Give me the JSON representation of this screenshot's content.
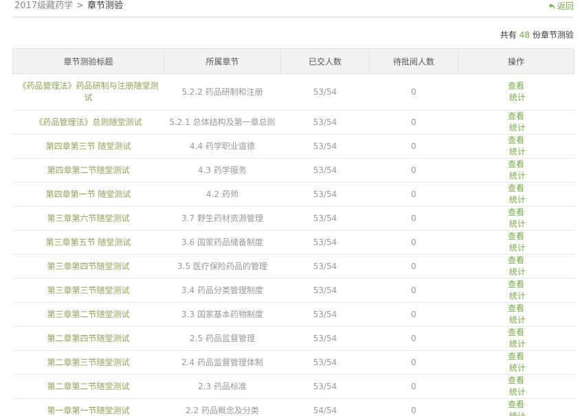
{
  "breadcrumb": {
    "course": "2017级藏药学",
    "separator": ">",
    "current": "章节测验"
  },
  "back": {
    "label": "返回",
    "icon": "return-arrow-icon"
  },
  "summary": {
    "prefix": "共有",
    "count": "48",
    "suffix": "份章节测验"
  },
  "colors": {
    "accent": "#78a949",
    "title_link": "#8ea45b",
    "header_bg": "#f2f2f2"
  },
  "table": {
    "headers": [
      "章节测验标题",
      "所属章节",
      "已交人数",
      "待批阅人数",
      "操作"
    ],
    "rows": [
      {
        "title": "《药品管理法》药品研制与注册随堂测试",
        "chapter": "5.2.2 药品研制和注册",
        "submitted": "53/54",
        "pending": "0",
        "view": "查看",
        "stats": "统计"
      },
      {
        "title": "《药品管理法》总则随堂测试",
        "chapter": "5.2.1 总体结构及第一章总则",
        "submitted": "53/54",
        "pending": "0",
        "view": "查看",
        "stats": "统计"
      },
      {
        "title": "第四章第三节 随堂测试",
        "chapter": "4.4 药学职业道德",
        "submitted": "53/54",
        "pending": "0",
        "view": "查看",
        "stats": "统计"
      },
      {
        "title": "第四章第二节随堂测试",
        "chapter": "4.3 药学服务",
        "submitted": "53/54",
        "pending": "0",
        "view": "查看",
        "stats": "统计"
      },
      {
        "title": "第四章第一节 随堂测试",
        "chapter": "4.2 药师",
        "submitted": "53/54",
        "pending": "0",
        "view": "查看",
        "stats": "统计"
      },
      {
        "title": "第三章第六节随堂测试",
        "chapter": "3.7 野生药材资源管理",
        "submitted": "53/54",
        "pending": "0",
        "view": "查看",
        "stats": "统计"
      },
      {
        "title": "第三章第五节 随堂测试",
        "chapter": "3.6 国家药品储备制度",
        "submitted": "53/54",
        "pending": "0",
        "view": "查看",
        "stats": "统计"
      },
      {
        "title": "第三章第四节随堂测试",
        "chapter": "3.5 医疗保险药品的管理",
        "submitted": "53/54",
        "pending": "0",
        "view": "查看",
        "stats": "统计"
      },
      {
        "title": "第三章第三节随堂测试",
        "chapter": "3.4 药品分类管理制度",
        "submitted": "53/54",
        "pending": "0",
        "view": "查看",
        "stats": "统计"
      },
      {
        "title": "第三章第二节随堂测试",
        "chapter": "3.3 国家基本药物制度",
        "submitted": "53/54",
        "pending": "0",
        "view": "查看",
        "stats": "统计"
      },
      {
        "title": "第二章第四节随堂测试",
        "chapter": "2.5 药品监督管理",
        "submitted": "53/54",
        "pending": "0",
        "view": "查看",
        "stats": "统计"
      },
      {
        "title": "第二章第三节随堂测试",
        "chapter": "2.4 药品监督管理体制",
        "submitted": "53/54",
        "pending": "0",
        "view": "查看",
        "stats": "统计"
      },
      {
        "title": "第二章第二节随堂测试",
        "chapter": "2.3 药品标准",
        "submitted": "53/54",
        "pending": "0",
        "view": "查看",
        "stats": "统计"
      },
      {
        "title": "第一章第一节随堂测试",
        "chapter": "2.2 药品概念及分类",
        "submitted": "54/54",
        "pending": "0",
        "view": "查看",
        "stats": "统计"
      }
    ]
  }
}
